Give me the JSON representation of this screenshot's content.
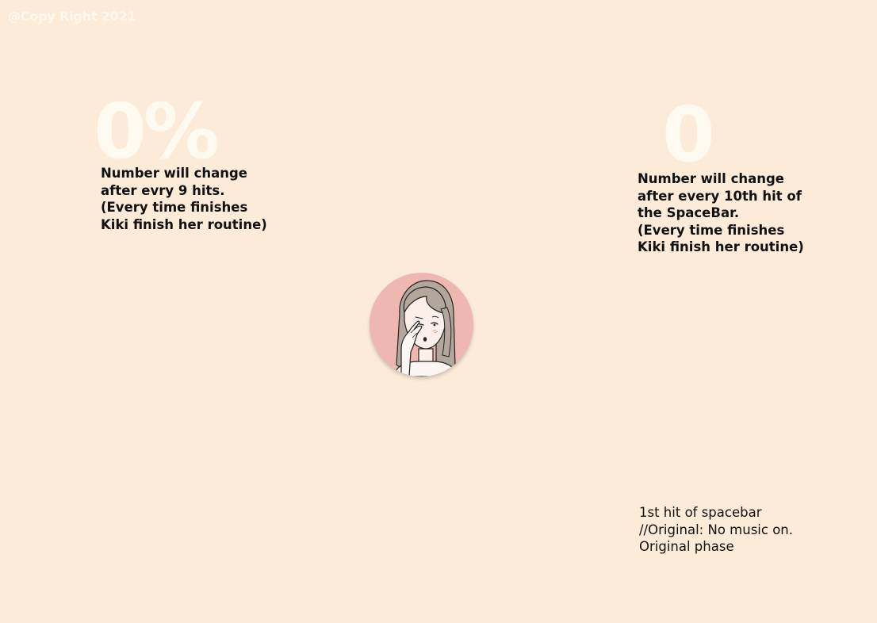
{
  "footer": {
    "copyright": "@Copy Right 2021"
  },
  "progress": {
    "value": "0%",
    "note": "Number will change\nafter evry 9 hits.\n(Every time finishes\nKiki finish her routine)"
  },
  "counter": {
    "value": "0",
    "note": "Number will change\nafter every 10th hit of\nthe SpaceBar.\n(Every time finishes\nKiki finish her routine)"
  },
  "phase": {
    "note": "1st hit of spacebar\n//Original: No music on.\nOriginal phase"
  },
  "avatar": {
    "icon": "girl-touching-eye-illustration",
    "bg_color": "#eeb7af",
    "hair_color": "#b3a69b"
  },
  "colors": {
    "background": "#fcebd9",
    "big_number": "#fffaf0",
    "text": "#111111"
  }
}
